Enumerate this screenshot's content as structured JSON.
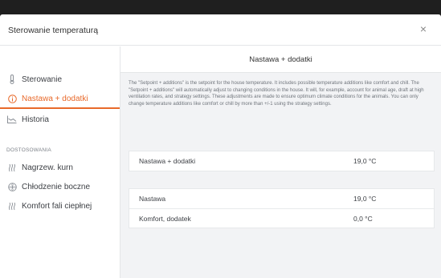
{
  "topbar": {
    "label": ""
  },
  "modal": {
    "title": "Sterowanie temperaturą",
    "close_glyph": "×"
  },
  "sidebar": {
    "items": [
      {
        "label": "Sterowanie",
        "icon": "thermometer-icon"
      },
      {
        "label": "Nastawa + dodatki",
        "icon": "info-circle-icon",
        "active": true
      },
      {
        "label": "Historia",
        "icon": "line-chart-icon"
      }
    ],
    "section_label": "DOSTOSOWANIA",
    "section_items": [
      {
        "label": "Nagrzew. kurn",
        "icon": "heat-waves-icon"
      },
      {
        "label": "Chłodzenie boczne",
        "icon": "fan-icon"
      },
      {
        "label": "Komfort fali ciepłnej",
        "icon": "heat-waves-icon"
      }
    ]
  },
  "content": {
    "title": "Nastawa + dodatki",
    "description": "The \"Setpoint + additions\" is the setpoint for the house temperature. It includes possible temperature additions like comfort and chill. The \"Setpoint + additions\" will automatically adjust to changing conditions in the house. It will, for example, account for animal age, draft at high ventilation rates, and strategy settings. These adjustments are made to ensure optimum climate conditions for the animals. You can only change temperature additions like comfort or chill by more than +/-1 using the strategy settings.",
    "card1": [
      {
        "label": "Nastawa + dodatki",
        "value": "19,0 °C"
      }
    ],
    "card2": [
      {
        "label": "Nastawa",
        "value": "19,0 °C"
      },
      {
        "label": "Komfort, dodatek",
        "value": "0,0 °C"
      }
    ]
  },
  "colors": {
    "accent": "#e8692a",
    "panel_bg": "#f2f3f5",
    "border": "#e4e6e8"
  }
}
